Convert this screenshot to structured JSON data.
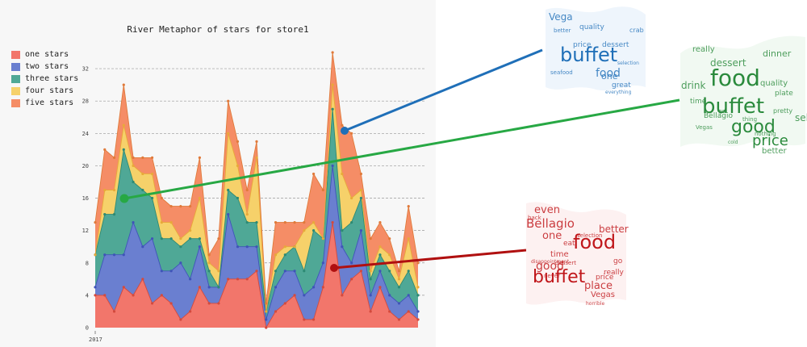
{
  "chart_data": {
    "type": "area",
    "stacked": true,
    "title": "River Metaphor of stars for store1",
    "x_tick_labels": [
      "2017"
    ],
    "y_ticks": [
      0,
      4,
      8,
      12,
      16,
      20,
      24,
      28,
      32
    ],
    "ylim": [
      0,
      34.5
    ],
    "grid": "horizontal dashed",
    "legend_placement": "top-left",
    "series": [
      {
        "name": "one stars",
        "color": "#f2766b",
        "values": [
          4,
          4,
          2,
          5,
          4,
          6,
          3,
          4,
          3,
          1,
          2,
          5,
          3,
          3,
          6,
          6,
          6,
          7,
          0,
          2,
          3,
          4,
          1,
          1,
          5,
          13,
          4,
          6,
          7,
          2,
          5,
          2,
          1,
          2,
          1
        ]
      },
      {
        "name": "two stars",
        "color": "#6a7fd0",
        "values": [
          1,
          5,
          7,
          4,
          9,
          4,
          8,
          3,
          4,
          7,
          4,
          5,
          2,
          2,
          8,
          4,
          4,
          3,
          1,
          3,
          4,
          3,
          3,
          4,
          3,
          7,
          6,
          2,
          5,
          2,
          2,
          2,
          2,
          2,
          1
        ]
      },
      {
        "name": "three stars",
        "color": "#4fa896",
        "values": [
          4,
          5,
          5,
          13,
          5,
          7,
          5,
          4,
          4,
          2,
          5,
          1,
          2,
          0,
          3,
          6,
          3,
          3,
          1,
          2,
          2,
          3,
          3,
          7,
          3,
          7,
          2,
          5,
          4,
          2,
          2,
          3,
          2,
          3,
          2
        ]
      },
      {
        "name": "four stars",
        "color": "#f6d16a",
        "values": [
          0,
          3,
          3,
          3,
          2,
          2,
          3,
          2,
          2,
          1,
          1,
          5,
          1,
          2,
          7,
          4,
          1,
          8,
          0,
          2,
          1,
          0,
          5,
          1,
          0,
          3,
          7,
          3,
          1,
          1,
          1,
          2,
          1,
          4,
          1
        ]
      },
      {
        "name": "five stars",
        "color": "#f58d66",
        "values": [
          4,
          5,
          4,
          5,
          1,
          2,
          2,
          3,
          2,
          4,
          3,
          5,
          1,
          4,
          4,
          3,
          3,
          2,
          1,
          4,
          3,
          3,
          1,
          6,
          6,
          4,
          6,
          8,
          2,
          4,
          3,
          2,
          1,
          4,
          3
        ]
      }
    ],
    "color_line": "#e07a3a"
  },
  "wordclouds": [
    {
      "name": "blue",
      "color": "#1f6fb8",
      "words": [
        "Vega",
        "buffet",
        "food",
        "quality",
        "dessert",
        "one",
        "price",
        "better",
        "great",
        "everything",
        "seafood",
        "crab",
        "selection"
      ]
    },
    {
      "name": "green",
      "color": "#2a8a3c",
      "words": [
        "food",
        "buffet",
        "really",
        "dessert",
        "drink",
        "crableg",
        "quality",
        "good",
        "price",
        "Bellagio",
        "better",
        "selection",
        "dinner",
        "plate",
        "pretty",
        "Vegas",
        "time",
        "nothing",
        "cold",
        "go",
        "thing"
      ]
    },
    {
      "name": "red",
      "color": "#c0161a",
      "words": [
        "even",
        "Bellagio",
        "one",
        "food",
        "good",
        "buffet",
        "selection",
        "eat",
        "time",
        "back",
        "never",
        "disappointment",
        "dessert",
        "place",
        "price",
        "really",
        "Vegas",
        "go",
        "better",
        "horrible"
      ]
    }
  ],
  "connector_colors": [
    "#1f6fb8",
    "#27a844",
    "#b01010"
  ]
}
